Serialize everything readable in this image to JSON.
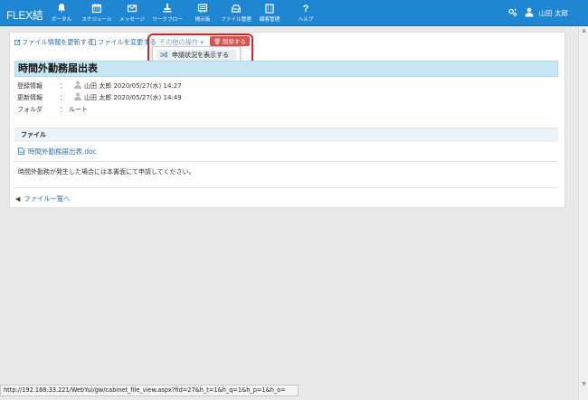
{
  "app": {
    "brand": "FLEX結"
  },
  "nav": [
    {
      "label": "ポータル",
      "icon": "bell-icon"
    },
    {
      "label": "スケジュール",
      "icon": "calendar-icon"
    },
    {
      "label": "メッセージ",
      "icon": "envelope-icon"
    },
    {
      "label": "ワークフロー",
      "icon": "stamp-icon"
    },
    {
      "label": "掲示板",
      "icon": "board-icon"
    },
    {
      "label": "ファイル管理",
      "icon": "drive-icon"
    },
    {
      "label": "顧客管理",
      "icon": "building-icon"
    },
    {
      "label": "ヘルプ",
      "icon": "question-icon"
    }
  ],
  "user": {
    "name": "山田 太郎"
  },
  "actions": {
    "update_info": "ファイル情報を更新する",
    "change_file": "ファイルを変更する",
    "other_ops": "その他の操作",
    "delete": "削除する",
    "show_status": "申請状況を表示する"
  },
  "document": {
    "title": "時間外勤務届出表",
    "registered_label": "登録情報",
    "registered_user": "山田 太郎",
    "registered_at": "2020/05/27(水) 14:27",
    "updated_label": "更新情報",
    "updated_user": "山田 太郎",
    "updated_at": "2020/05/27(水) 14:49",
    "folder_label": "フォルダ",
    "folder_value": "ルート",
    "colon": "："
  },
  "files": {
    "header": "ファイル",
    "file_name": "時間外勤務届出表.doc",
    "description": "時間外勤務が発生した場合には本書面にて申請してください。"
  },
  "back_link": "ファイル一覧へ",
  "status_url": "http://192.168.33.221/WebYui/gw/cabinet_file_view.aspx?fid=27&h_t=1&h_q=1&h_p=1&h_o=",
  "colors": {
    "nav_bg": "#1f86d4",
    "title_bg": "#c5e6f2",
    "delete_bg": "#d9534f",
    "highlight": "#e02020",
    "link": "#2a6fb5"
  }
}
